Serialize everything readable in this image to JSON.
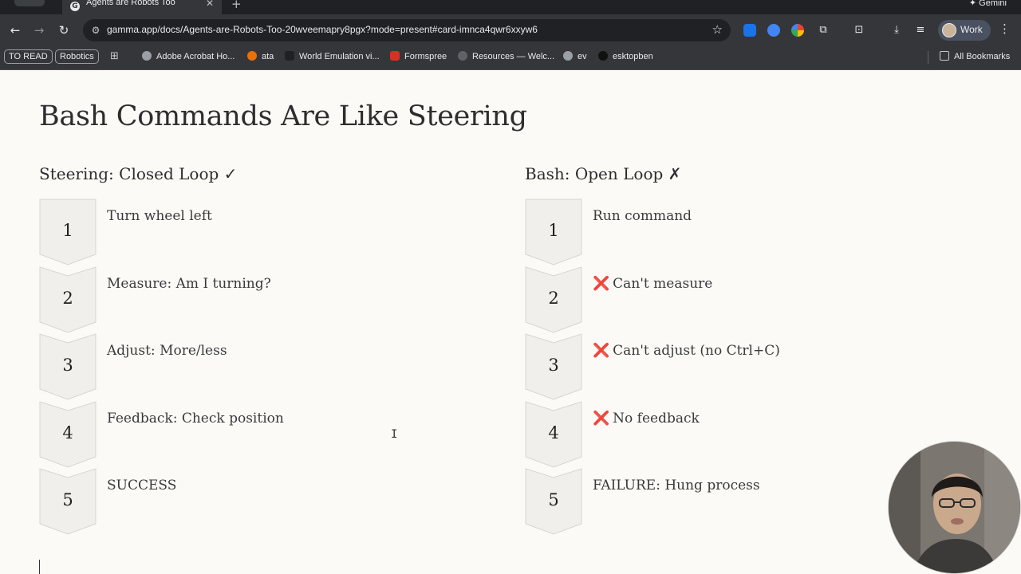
{
  "browser": {
    "tab_title": "Agents are Robots Too",
    "tab_favicon": "G",
    "gemini_label": "Gemini",
    "url": "gamma.app/docs/Agents-are-Robots-Too-20wveemapry8pgx?mode=present#card-imnca4qwr6xxyw6",
    "profile_label": "Work",
    "bookmarks": {
      "badges": [
        "TO READ",
        "Robotics"
      ],
      "items": [
        {
          "label": "Adobe Acrobat Ho...",
          "color": "#5f6368"
        },
        {
          "label": "ata",
          "color": "#e8710a"
        },
        {
          "label": "World Emulation vi...",
          "color": "#202124"
        },
        {
          "label": "Formspree",
          "color": "#d93025"
        },
        {
          "label": "Resources — Welc...",
          "color": "#5f6368"
        },
        {
          "label": "ev",
          "color": "#5f6368"
        },
        {
          "label": "esktopben",
          "color": "#111111"
        }
      ],
      "all_bookmarks": "All Bookmarks"
    }
  },
  "slide": {
    "title": "Bash Commands Are Like Steering",
    "left": {
      "heading": "Steering: Closed Loop ✓",
      "steps": [
        {
          "num": "1",
          "text": "Turn wheel left"
        },
        {
          "num": "2",
          "text": "Measure: Am I turning?"
        },
        {
          "num": "3",
          "text": "Adjust: More/less"
        },
        {
          "num": "4",
          "text": "Feedback: Check position"
        },
        {
          "num": "5",
          "text": "SUCCESS"
        }
      ]
    },
    "right": {
      "heading": "Bash: Open Loop ✗",
      "x_mark": "❌",
      "steps": [
        {
          "num": "1",
          "text": "Run command"
        },
        {
          "num": "2",
          "text": "Can't measure"
        },
        {
          "num": "3",
          "text": "Can't adjust (no Ctrl+C)"
        },
        {
          "num": "4",
          "text": "No feedback"
        },
        {
          "num": "5",
          "text": "FAILURE: Hung process"
        }
      ]
    }
  },
  "colors": {
    "failure_mark": "#d32f2f",
    "badge_fill": "#f1efeb",
    "badge_stroke": "#d9d5ce",
    "slide_bg": "#fbfaf7"
  }
}
